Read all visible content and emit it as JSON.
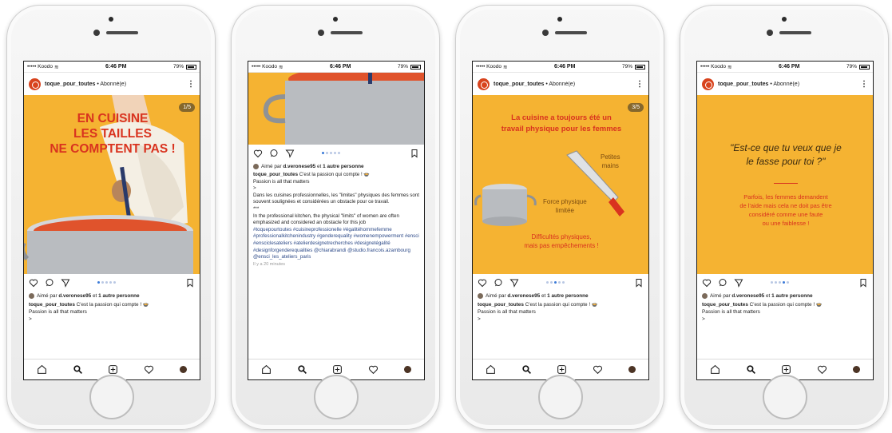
{
  "status_bar": {
    "carrier": "••••• Koodo",
    "time": "6:46 PM",
    "battery": "79%"
  },
  "phones": [
    {
      "header": {
        "username": "toque_pour_toutes",
        "suffix": " • Abonné(e)"
      },
      "slide": {
        "counter": "1/5",
        "title_lines": [
          "EN CUISINE",
          "LES TAILLES",
          "NE COMPTENT PAS !"
        ]
      },
      "likes": {
        "prefix": "Aimé par ",
        "user": "d.veronese95",
        "middle": " et ",
        "others": "1 autre personne"
      },
      "caption": {
        "user": "toque_pour_toutes",
        "text": " C'est la passion qui compte ! 🍲",
        "line2": "Passion is all that matters",
        "line3": ">"
      }
    },
    {
      "likes": {
        "prefix": "Aimé par ",
        "user": "d.veronese95",
        "middle": " et ",
        "others": "1 autre personne"
      },
      "caption": {
        "user": "toque_pour_toutes",
        "text": " C'est la passion qui compte ! 🍲",
        "line2": "Passion is all that matters",
        "line3": ">",
        "para_fr": "Dans les cuisines professionnelles, les \"limites\" physiques des femmes sont souvent soulignées et considérées un obstacle pour ce travail.",
        "sep": "***",
        "para_en": "In the professional kitchen, the physical \"limits\" of women are often emphasized and considered an obstacle for this job",
        "hashtags": "#toquepourtoutes #cuisineprofessionelle #égalitéhommefemme #professionalkitchenindustry #genderequality #womenempowerment #ensci #ensciclesateliers #atelierdesignetrecherches #designetégalité #designforgenderequalities @chiarabrandi @studio.francois.azambourg @ensci_les_ateliers_paris",
        "time": "Il y a 20 minutes"
      }
    },
    {
      "header": {
        "username": "toque_pour_toutes",
        "suffix": " • Abonné(e)"
      },
      "slide": {
        "counter": "3/5",
        "title_lines": [
          "La cuisine a toujours été un",
          "travail physique pour les femmes"
        ],
        "label_small": [
          "Petites",
          "mains"
        ],
        "label_force": [
          "Force physique",
          "limitée"
        ],
        "footer_lines": [
          "Difficultés physiques,",
          "mais pas empêchements !"
        ]
      },
      "likes": {
        "prefix": "Aimé par ",
        "user": "d.veronese95",
        "middle": " et ",
        "others": "1 autre personne"
      },
      "caption": {
        "user": "toque_pour_toutes",
        "text": " C'est la passion qui compte ! 🍲",
        "line2": "Passion is all that matters",
        "line3": ">"
      }
    },
    {
      "header": {
        "username": "toque_pour_toutes",
        "suffix": " • Abonné(e)"
      },
      "slide": {
        "quote_lines": [
          "\"Est-ce que tu veux que je",
          "le fasse pour toi ?\""
        ],
        "body_lines": [
          "Parfois, les femmes demandent",
          "de l'aide mais cela ne doit pas être",
          "considéré comme une faute",
          "ou une faiblesse !"
        ]
      },
      "likes": {
        "prefix": "Aimé par ",
        "user": "d.veronese95",
        "middle": " et ",
        "others": "1 autre personne"
      },
      "caption": {
        "user": "toque_pour_toutes",
        "text": " C'est la passion qui compte ! 🍲",
        "line2": "Passion is all that matters",
        "line3": ">"
      }
    }
  ],
  "colors": {
    "slide_bg": "#f5b332",
    "title_red": "#d9331f",
    "pot_gray": "#b9bcc0",
    "sauce": "#e0532c",
    "link_blue": "#2d4a88"
  },
  "icons": [
    "heart-icon",
    "comment-icon",
    "share-icon",
    "bookmark-icon",
    "home-icon",
    "search-icon",
    "add-icon",
    "activity-icon",
    "profile-icon",
    "more-icon",
    "wifi-icon",
    "battery-icon"
  ]
}
